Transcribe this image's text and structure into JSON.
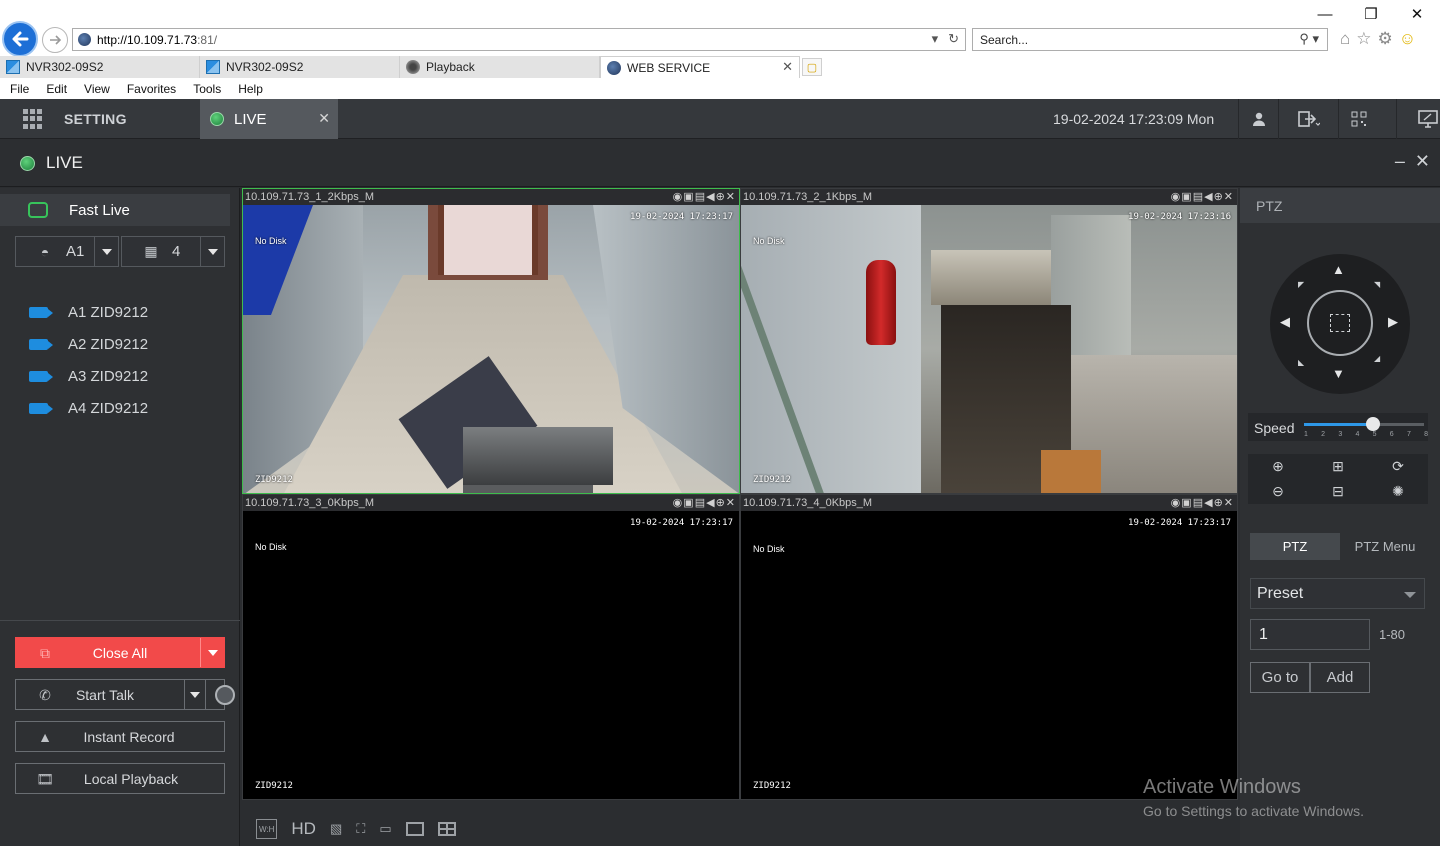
{
  "browser": {
    "url_host": "http://10.109.71.73",
    "url_rest": ":81/",
    "search_placeholder": "Search...",
    "tabs": [
      {
        "label": "NVR302-09S2"
      },
      {
        "label": "NVR302-09S2"
      },
      {
        "label": "Playback"
      },
      {
        "label": "WEB SERVICE"
      }
    ],
    "menu": [
      "File",
      "Edit",
      "View",
      "Favorites",
      "Tools",
      "Help"
    ]
  },
  "header": {
    "setting_label": "SETTING",
    "live_tab_label": "LIVE",
    "datetime": "19-02-2024 17:23:09 Mon"
  },
  "live_title": "LIVE",
  "left_panel": {
    "fast_live": "Fast Live",
    "stream_select": "A1",
    "layout_select": "4",
    "cameras": [
      {
        "label": "A1 ZID9212"
      },
      {
        "label": "A2 ZID9212"
      },
      {
        "label": "A3 ZID9212"
      },
      {
        "label": "A4 ZID9212"
      }
    ],
    "close_all": "Close All",
    "start_talk": "Start Talk",
    "instant_record": "Instant Record",
    "local_playback": "Local Playback"
  },
  "video_tiles": [
    {
      "title": "10.109.71.73_1_2Kbps_M",
      "timestamp": "19-02-2024 17:23:17",
      "status": "No Disk",
      "name": "ZID9212"
    },
    {
      "title": "10.109.71.73_2_1Kbps_M",
      "timestamp": "19-02-2024 17:23:16",
      "status": "No Disk",
      "name": "ZID9212"
    },
    {
      "title": "10.109.71.73_3_0Kbps_M",
      "timestamp": "19-02-2024 17:23:17",
      "status": "No Disk",
      "name": "ZID9212"
    },
    {
      "title": "10.109.71.73_4_0Kbps_M",
      "timestamp": "19-02-2024 17:23:17",
      "status": "No Disk",
      "name": "ZID9212"
    }
  ],
  "bottom_toolbar": {
    "hd_label": "HD",
    "wh_label": "W:H"
  },
  "ptz": {
    "title": "PTZ",
    "speed_label": "Speed",
    "speed_value": 5,
    "speed_ticks": [
      "1",
      "2",
      "3",
      "4",
      "5",
      "6",
      "7",
      "8"
    ],
    "tab_ptz": "PTZ",
    "tab_menu": "PTZ Menu",
    "preset_select": "Preset",
    "preset_value": "1",
    "preset_range": "1-80",
    "goto_label": "Go to",
    "add_label": "Add"
  },
  "watermark": {
    "line1": "Activate Windows",
    "line2": "Go to Settings to activate Windows."
  }
}
